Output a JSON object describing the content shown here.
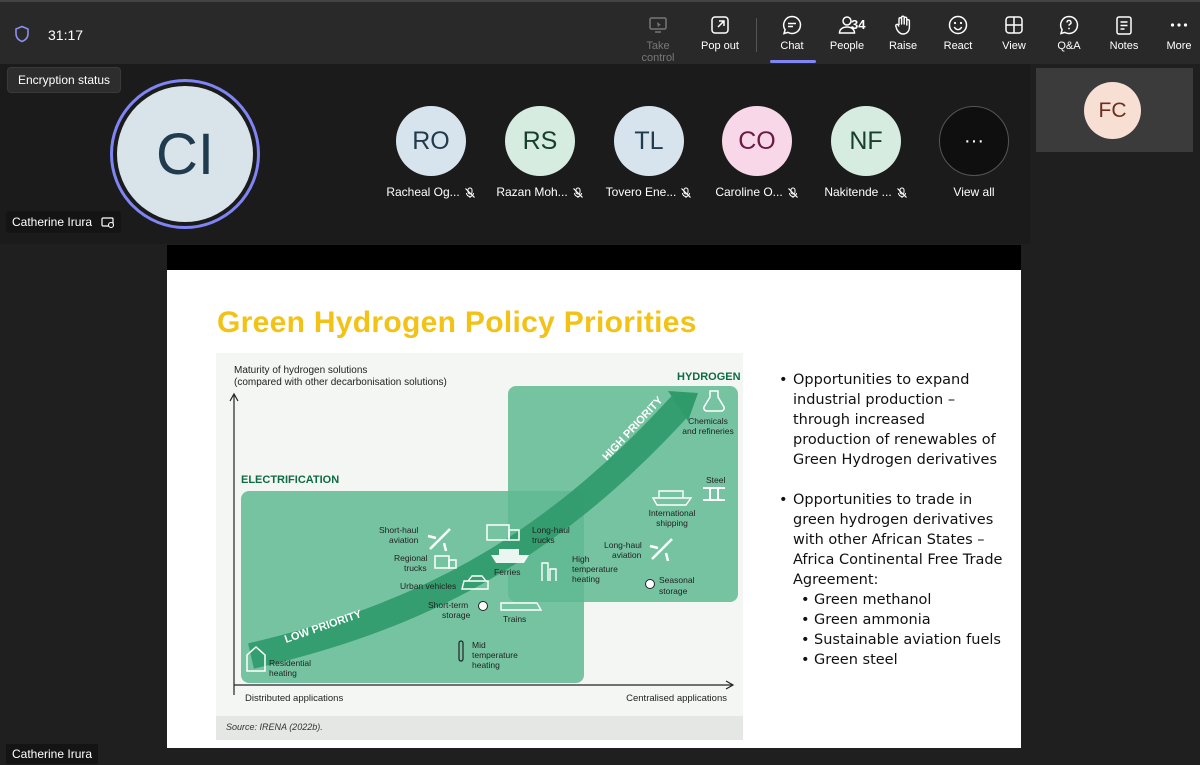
{
  "meeting": {
    "timer": "31:17",
    "tooltip": "Encryption status"
  },
  "toolbar": [
    {
      "label": "Take control",
      "icon": "take-control-icon",
      "disabled": true
    },
    {
      "label": "Pop out",
      "icon": "pop-out-icon"
    },
    {
      "label": "Chat",
      "icon": "chat-icon",
      "active": true
    },
    {
      "label": "People",
      "icon": "people-icon",
      "count": "34"
    },
    {
      "label": "Raise",
      "icon": "raise-hand-icon"
    },
    {
      "label": "React",
      "icon": "react-icon"
    },
    {
      "label": "View",
      "icon": "view-icon"
    },
    {
      "label": "Q&A",
      "icon": "qa-icon"
    },
    {
      "label": "Notes",
      "icon": "notes-icon"
    },
    {
      "label": "More",
      "icon": "more-icon"
    }
  ],
  "speaker": {
    "initials": "CI",
    "name": "Catherine Irura"
  },
  "participants": [
    {
      "initials": "RO",
      "name": "Racheal Og...",
      "color": "#d7e4ee",
      "text": "#1f3b4d"
    },
    {
      "initials": "RS",
      "name": "Razan Moh...",
      "color": "#d6ece1",
      "text": "#17402c"
    },
    {
      "initials": "TL",
      "name": "Tovero Ene...",
      "color": "#d7e4ee",
      "text": "#1f3b4d"
    },
    {
      "initials": "CO",
      "name": "Caroline O...",
      "color": "#f8d7e8",
      "text": "#6a1b44"
    },
    {
      "initials": "NF",
      "name": "Nakitende ...",
      "color": "#d6ece1",
      "text": "#17402c"
    }
  ],
  "view_all": {
    "glyph": "···",
    "label": "View all"
  },
  "side_tile": {
    "initials": "FC"
  },
  "slide": {
    "title": "Green Hydrogen Policy Priorities",
    "figure": {
      "y_title_1": "Maturity of hydrogen solutions",
      "y_title_2": "(compared with other decarbonisation solutions)",
      "hydrogen_label": "HYDROGEN",
      "electrification_label": "ELECTRIFICATION",
      "high_priority": "HIGH PRIORITY",
      "low_priority": "LOW PRIORITY",
      "x_left": "Distributed applications",
      "x_right": "Centralised applications",
      "source": "Source: IRENA (2022b).",
      "items": {
        "chemicals_1": "Chemicals",
        "chemicals_2": "and refineries",
        "steel": "Steel",
        "intl_ship_1": "International",
        "intl_ship_2": "shipping",
        "lh_aviation_1": "Long-haul",
        "lh_aviation_2": "aviation",
        "seasonal_1": "Seasonal",
        "seasonal_2": "storage",
        "sh_aviation_1": "Short-haul",
        "sh_aviation_2": "aviation",
        "lh_trucks_1": "Long-haul",
        "lh_trucks_2": "trucks",
        "reg_trucks_1": "Regional",
        "reg_trucks_2": "trucks",
        "ferries": "Ferries",
        "urban": "Urban vehicles",
        "hth_1": "High",
        "hth_2": "temperature",
        "hth_3": "heating",
        "st_storage_1": "Short-term",
        "st_storage_2": "storage",
        "trains": "Trains",
        "mth_1": "Mid",
        "mth_2": "temperature",
        "mth_3": "heating",
        "res_1": "Residential",
        "res_2": "heating"
      }
    },
    "bullets": [
      "Opportunities to expand industrial production – through increased production of renewables of Green Hydrogen derivatives",
      "Opportunities to trade in green hydrogen derivatives with other African States – Africa Continental Free Trade Agreement:"
    ],
    "sub_bullets": [
      "Green methanol",
      "Green ammonia",
      "Sustainable aviation fuels",
      "Green steel"
    ]
  },
  "presenter_label": "Catherine Irura",
  "colors": {
    "accent": "#7f85f5",
    "title_yellow": "#f2c216",
    "green_box": "#5fba93",
    "arrow_green": "#2f9a6a"
  }
}
